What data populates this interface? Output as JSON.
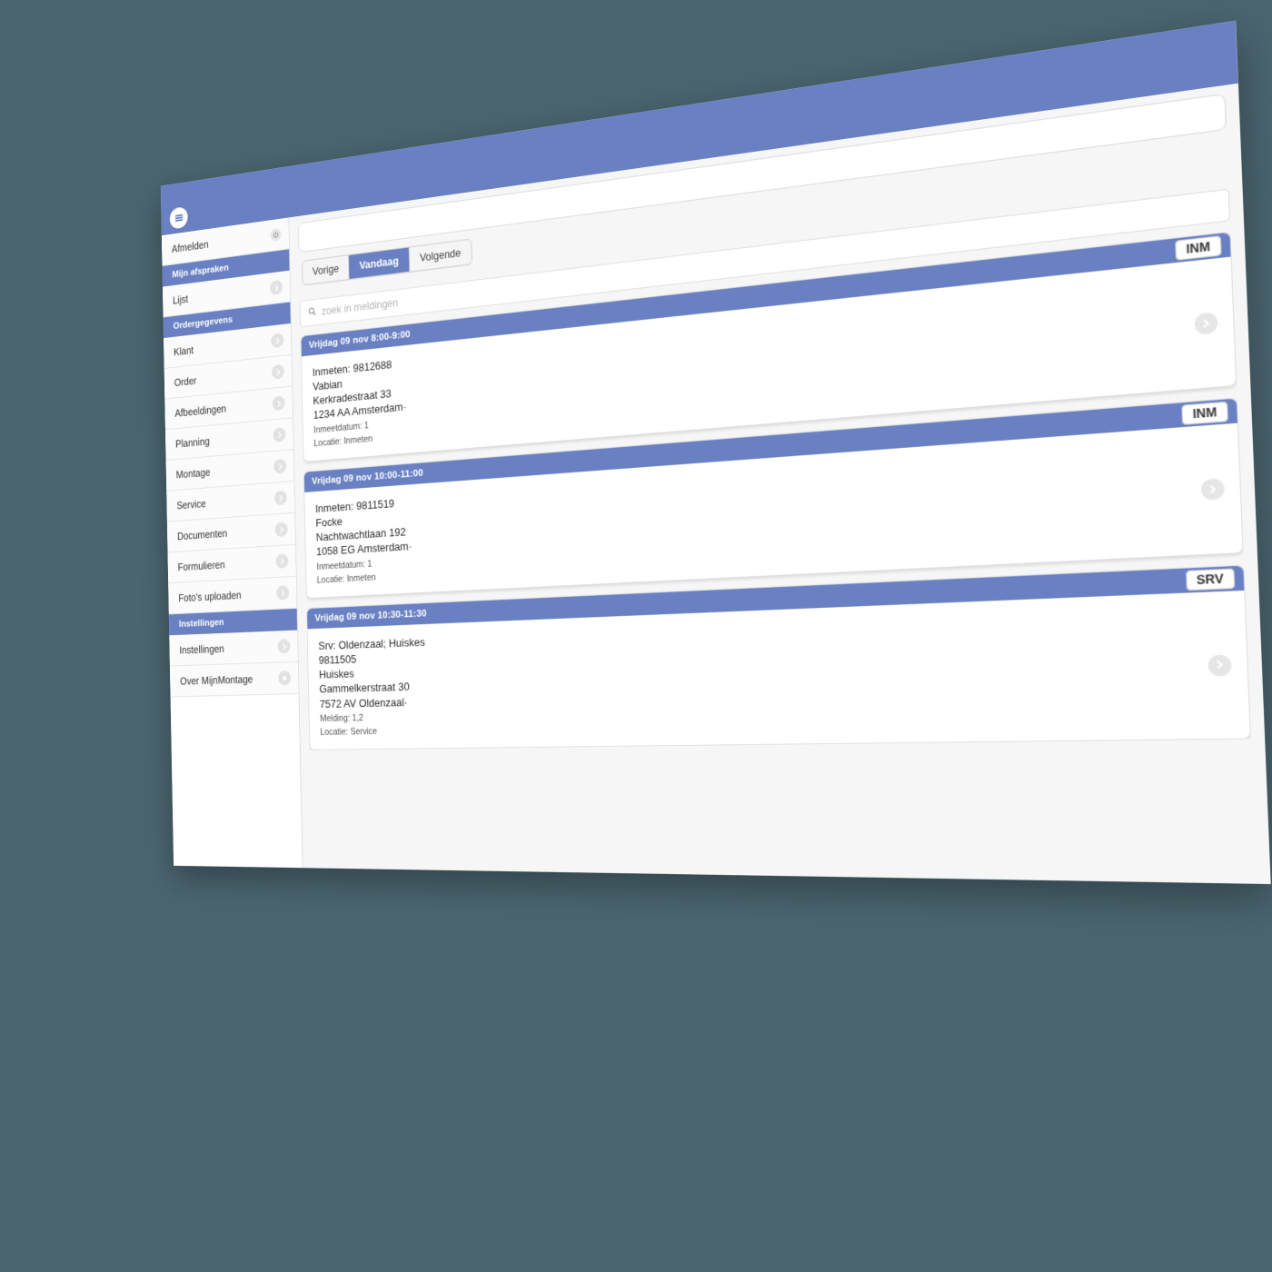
{
  "theme": {
    "accent": "#6980c3",
    "backdrop": "#4a6570",
    "page_bg": "#f6f6f6",
    "card_bg": "#ffffff"
  },
  "app": {
    "name": "MijnMontage"
  },
  "topbar": {
    "menu_icon": "hamburger-icon"
  },
  "sidebar": {
    "logout": {
      "label": "Afmelden",
      "icon": "power-icon"
    },
    "sections": [
      {
        "header": "Mijn afspraken",
        "items": [
          {
            "label": "Lijst",
            "icon": "chevron-right-icon"
          }
        ]
      },
      {
        "header": "Ordergegevens",
        "items": [
          {
            "label": "Klant",
            "icon": "chevron-right-icon"
          },
          {
            "label": "Order",
            "icon": "chevron-right-icon"
          },
          {
            "label": "Afbeeldingen",
            "icon": "chevron-right-icon"
          },
          {
            "label": "Planning",
            "icon": "chevron-right-icon"
          },
          {
            "label": "Montage",
            "icon": "chevron-right-icon"
          },
          {
            "label": "Service",
            "icon": "chevron-right-icon"
          },
          {
            "label": "Documenten",
            "icon": "chevron-right-icon"
          },
          {
            "label": "Formulieren",
            "icon": "chevron-right-icon"
          },
          {
            "label": "Foto's uploaden",
            "icon": "chevron-right-icon"
          }
        ]
      },
      {
        "header": "Instellingen",
        "items": [
          {
            "label": "Instellingen",
            "icon": "chevron-right-icon"
          },
          {
            "label": "Over MijnMontage",
            "icon": "info-icon"
          }
        ]
      }
    ]
  },
  "main": {
    "top_field_value": "",
    "tabs": [
      {
        "label": "Vorige",
        "active": false
      },
      {
        "label": "Vandaag",
        "active": true
      },
      {
        "label": "Volgende",
        "active": false
      }
    ],
    "search": {
      "placeholder": "zoek in meldingen",
      "value": "",
      "icon": "search-icon"
    },
    "appointments": [
      {
        "time": "Vrijdag 09 nov 8:00-9:00",
        "badge": "INM",
        "lines": [
          "Inmeten: 9812688",
          "Vabian",
          "Kerkradestraat 33",
          "1234 AA Amsterdam·"
        ],
        "meta": [
          "Inmeetdatum: 1",
          "Locatie: Inmeten"
        ],
        "arrow_icon": "chevron-right-icon"
      },
      {
        "time": "Vrijdag 09 nov 10:00-11:00",
        "badge": "INM",
        "lines": [
          "Inmeten: 9811519",
          "Focke",
          "Nachtwachtlaan 192",
          "1058 EG Amsterdam·"
        ],
        "meta": [
          "Inmeetdatum: 1",
          "Locatie: Inmeten"
        ],
        "arrow_icon": "chevron-right-icon"
      },
      {
        "time": "Vrijdag 09 nov 10:30-11:30",
        "badge": "SRV",
        "lines": [
          "Srv: Oldenzaal; Huiskes",
          "9811505",
          "Huiskes",
          "Gammelkerstraat 30",
          "7572 AV Oldenzaal·"
        ],
        "meta": [
          "Melding: 1,2",
          "Locatie: Service"
        ],
        "arrow_icon": "chevron-right-icon"
      }
    ]
  }
}
